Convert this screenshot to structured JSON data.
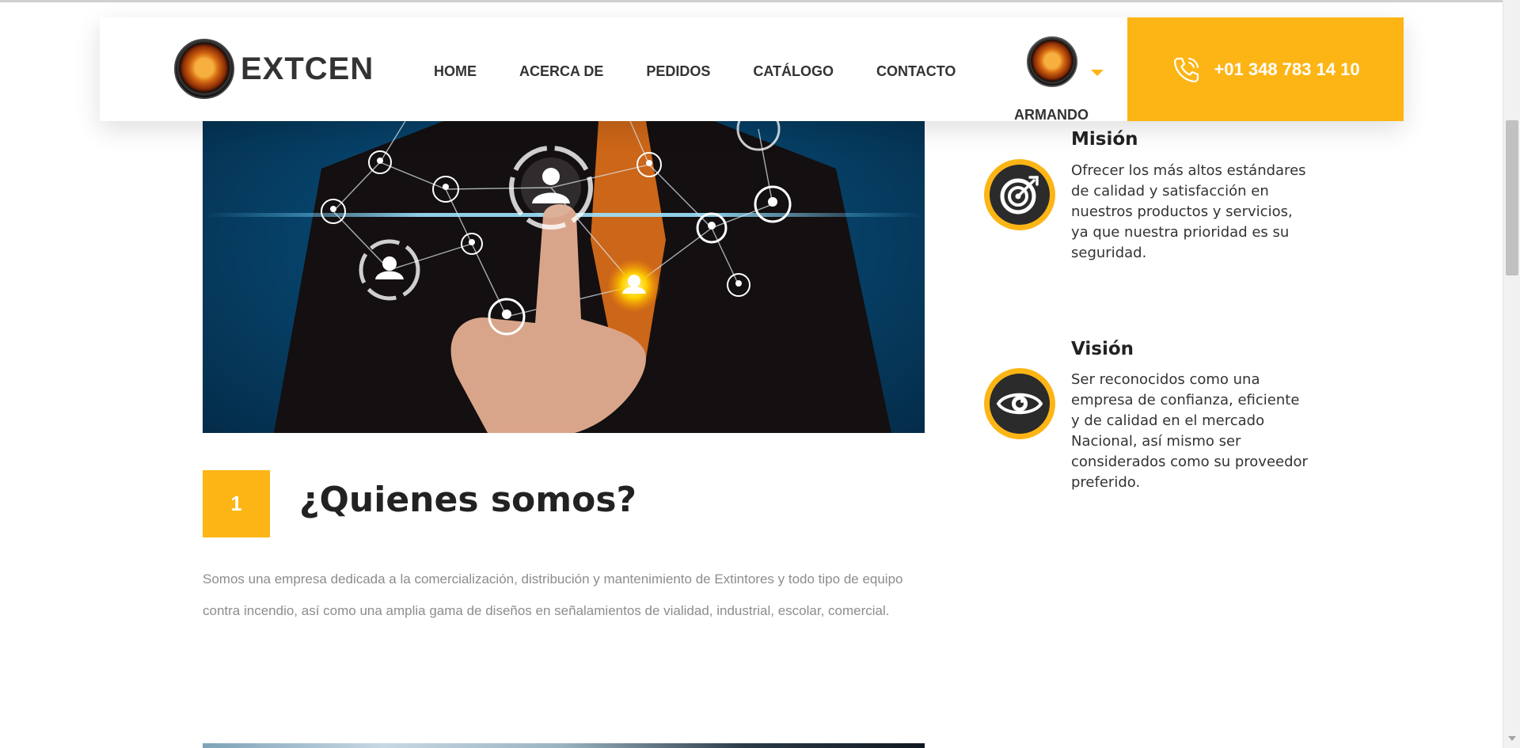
{
  "header": {
    "brand_name": "EXTCEN",
    "nav": [
      "HOME",
      "ACERCA DE",
      "PEDIDOS",
      "CATÁLOGO",
      "CONTACTO"
    ],
    "user_name": "ARMANDO",
    "phone": "+01 348 783 14 10"
  },
  "about": {
    "number": "1",
    "title": "¿Quienes somos?",
    "body": "Somos una empresa dedicada a la comercialización, distribución y mantenimiento de Extintores y todo tipo de equipo contra incendio, así como una amplia gama de diseños en señalamientos de vialidad, industrial, escolar, comercial."
  },
  "features": [
    {
      "title": "Misión",
      "icon": "target-icon",
      "text": "Ofrecer los más altos estándares de calidad y satisfacción en nuestros productos y servicios, ya que nuestra prioridad es su seguridad."
    },
    {
      "title": "Visión",
      "icon": "eye-icon",
      "text": "Ser reconocidos como una empresa de confianza, eficiente y de calidad en el mercado Nacional, así mismo ser considerados como su proveedor preferido."
    }
  ],
  "colors": {
    "accent": "#fdb515",
    "text_dark": "#222222",
    "text_muted": "#8d8d8d"
  }
}
